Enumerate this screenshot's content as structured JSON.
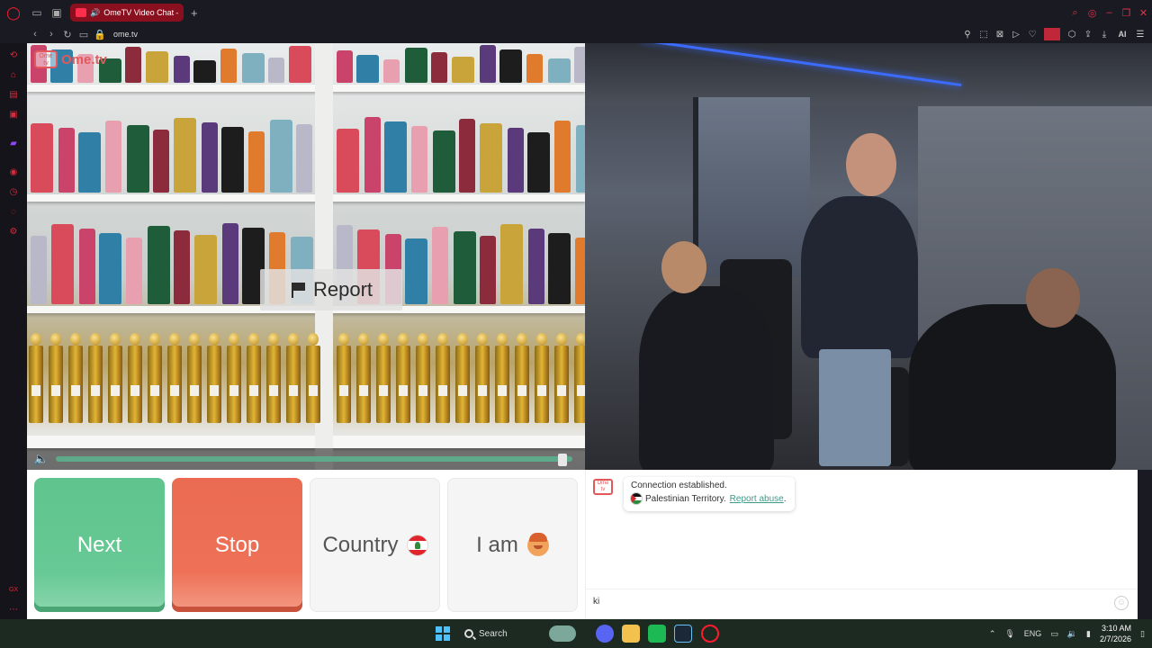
{
  "browser": {
    "tab_title": "OmeTV Video Chat — ...",
    "url": "ome.tv",
    "ai_label": "AI",
    "new_tab_icon": "plus-icon"
  },
  "video_left": {
    "logo_text": "Ome.tv",
    "logo_box": "Ome tv",
    "report_label": "Report",
    "volume_level": 0.98
  },
  "controls": {
    "next_label": "Next",
    "stop_label": "Stop",
    "country_label": "Country",
    "iam_label": "I am"
  },
  "chat": {
    "logo_box": "Ome tv",
    "connection_text": "Connection established.",
    "country_text": "Palestinian Territory.",
    "report_abuse_label": "Report abuse",
    "report_abuse_suffix": ".",
    "input_value": "ki"
  },
  "taskbar": {
    "search_label": "Search",
    "lang": "ENG",
    "time": "3:10 AM",
    "date": "2/7/2026"
  },
  "sidebar": {
    "bottom_label": "GX"
  },
  "colors": {
    "next": "#67c995",
    "stop": "#ee7157",
    "opera_red": "#ff1b2d",
    "link": "#3f9a8a"
  }
}
